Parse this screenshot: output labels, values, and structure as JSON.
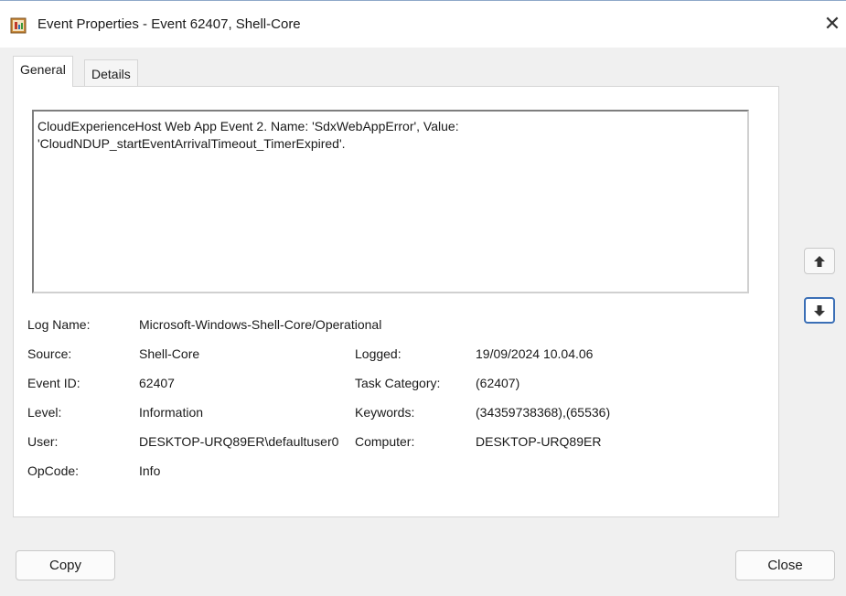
{
  "window": {
    "title": "Event Properties - Event 62407, Shell-Core",
    "close_glyph": "✕",
    "icon": "event-viewer-icon"
  },
  "tabs": [
    {
      "label": "General",
      "active": true
    },
    {
      "label": "Details",
      "active": false
    }
  ],
  "message": "CloudExperienceHost Web App Event 2. Name: 'SdxWebAppError', Value: 'CloudNDUP_startEventArrivalTimeout_TimerExpired'.",
  "fields": {
    "log_name": {
      "label": "Log Name:",
      "value": "Microsoft-Windows-Shell-Core/Operational"
    },
    "source": {
      "label": "Source:",
      "value": "Shell-Core"
    },
    "logged": {
      "label": "Logged:",
      "value": "19/09/2024 10.04.06"
    },
    "event_id": {
      "label": "Event ID:",
      "value": "62407"
    },
    "task_category": {
      "label": "Task Category:",
      "value": "(62407)"
    },
    "level": {
      "label": "Level:",
      "value": "Information"
    },
    "keywords": {
      "label": "Keywords:",
      "value": "(34359738368),(65536)"
    },
    "user": {
      "label": "User:",
      "value": "DESKTOP-URQ89ER\\defaultuser0"
    },
    "computer": {
      "label": "Computer:",
      "value": "DESKTOP-URQ89ER"
    },
    "opcode": {
      "label": "OpCode:",
      "value": "Info"
    }
  },
  "nav": {
    "up_icon": "arrow-up-icon",
    "down_icon": "arrow-down-icon"
  },
  "buttons": {
    "copy": "Copy",
    "close": "Close"
  },
  "colors": {
    "focus_border": "#3b6fb6",
    "panel_background": "#ffffff",
    "window_background": "#f0f0f0"
  }
}
